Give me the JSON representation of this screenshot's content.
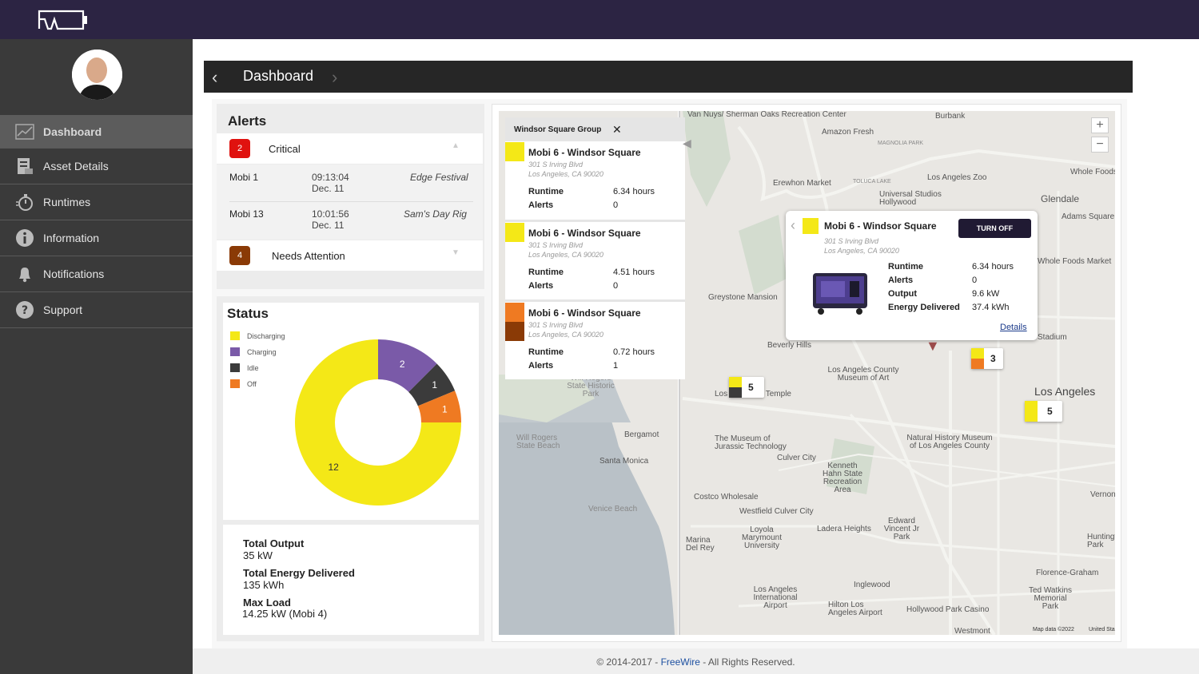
{
  "app": {
    "logo_icon": "freewire-logo-icon",
    "brand_color": "#2c2443"
  },
  "sidebar": {
    "items": [
      {
        "label": "Dashboard",
        "icon": "chart-icon",
        "active": true
      },
      {
        "label": "Asset Details",
        "icon": "asset-icon"
      },
      {
        "label": "Runtimes",
        "icon": "stopwatch-icon"
      },
      {
        "label": "Information",
        "icon": "info-icon"
      },
      {
        "label": "Notifications",
        "icon": "bell-icon"
      },
      {
        "label": "Support",
        "icon": "question-icon"
      }
    ]
  },
  "header": {
    "title": "Dashboard"
  },
  "alerts": {
    "title": "Alerts",
    "critical": {
      "count": "2",
      "label": "Critical",
      "color": "#e0120f"
    },
    "rows": [
      {
        "asset": "Mobi 1",
        "time": "09:13:04",
        "date": "Dec. 11",
        "event": "Edge Festival"
      },
      {
        "asset": "Mobi 13",
        "time": "10:01:56",
        "date": "Dec. 11",
        "event": "Sam's Day Rig"
      }
    ],
    "attention": {
      "count": "4",
      "label": "Needs Attention",
      "color": "#8a3a06"
    }
  },
  "status": {
    "title": "Status",
    "legend": [
      {
        "label": "Discharging",
        "color": "#f4e817"
      },
      {
        "label": "Charging",
        "color": "#7a5aa8"
      },
      {
        "label": "Idle",
        "color": "#3b3b3b"
      },
      {
        "label": "Off",
        "color": "#ef7a22"
      }
    ],
    "chart_data": {
      "type": "pie",
      "categories": [
        "Discharging",
        "Charging",
        "Idle",
        "Off"
      ],
      "values": [
        12,
        2,
        1,
        1
      ],
      "colors": [
        "#f4e817",
        "#7a5aa8",
        "#3b3b3b",
        "#ef7a22"
      ]
    },
    "totals": [
      {
        "label": "Total Output",
        "value": "35 kW"
      },
      {
        "label": "Total Energy Delivered",
        "value": "135 kWh"
      },
      {
        "label": "Max Load",
        "value": "14.25 kW (Mobi 4)"
      }
    ]
  },
  "map": {
    "group": "Windsor Square Group",
    "list": [
      {
        "name": "Mobi 6 - Windsor Square",
        "address1": "301 S Irving Blvd",
        "address2": "Los Angeles, CA 90020",
        "runtime_label": "Runtime",
        "runtime": "6.34 hours",
        "alerts_label": "Alerts",
        "alerts": "0",
        "colors": [
          "#f4e817"
        ]
      },
      {
        "name": "Mobi 6 - Windsor Square",
        "address1": "301 S Irving Blvd",
        "address2": "Los Angeles, CA 90020",
        "runtime_label": "Runtime",
        "runtime": "4.51 hours",
        "alerts_label": "Alerts",
        "alerts": "0",
        "colors": [
          "#f4e817"
        ]
      },
      {
        "name": "Mobi 6 - Windsor Square",
        "address1": "301 S Irving Blvd",
        "address2": "Los Angeles, CA 90020",
        "runtime_label": "Runtime",
        "runtime": "0.72 hours",
        "alerts_label": "Alerts",
        "alerts": "1",
        "colors": [
          "#ef7a22",
          "#8a3a06"
        ]
      }
    ],
    "popup": {
      "name": "Mobi 6 - Windsor Square",
      "address1": "301 S Irving Blvd",
      "address2": "Los Angeles, CA 90020",
      "button": "TURN OFF",
      "fields": [
        {
          "k": "Runtime",
          "v": "6.34 hours"
        },
        {
          "k": "Alerts",
          "v": "0"
        },
        {
          "k": "Output",
          "v": "9.6 kW"
        },
        {
          "k": "Energy Delivered",
          "v": "37.4 kWh"
        }
      ],
      "details": "Details"
    },
    "clusters": [
      "3",
      "5",
      "5"
    ],
    "labels": [
      "Van Nuys/ Sherman Oaks Recreation Center",
      "Burbank",
      "Amazon Fresh",
      "MAGNOLIA PARK",
      "Whole Foods",
      "Los Angeles Zoo",
      "Glendale",
      "Erewhon Market",
      "TOLUCA LAKE",
      "Universal Studios Hollywood",
      "Adams Square",
      "Greystone Mansion",
      "Beverly Hills",
      "Los Angeles County Museum of Art",
      "Los Angeles",
      "Santa Monica",
      "Bergamot",
      "Will Rogers State Historic Park",
      "Will Rogers State Beach",
      "Venice Beach",
      "The Museum of Jurassic Technology",
      "Culver City",
      "Kenneth Hahn State Recreation Area",
      "Natural History Museum of Los Angeles County",
      "Costco Wholesale",
      "Westfield Culver City",
      "Ladera Heights",
      "Loyola Marymount University",
      "Marina Del Rey",
      "Edward Vincent Jr Park",
      "Inglewood",
      "Los Angeles International Airport",
      "Hilton Los Angeles Airport",
      "Hollywood Park Casino",
      "Ted Watkins Memorial Park",
      "Florence-Graham",
      "Vernon",
      "Huntington Park",
      "Westmont",
      "Whole Foods Market",
      "Stadium",
      "Los California Temple",
      "Map data ©2022",
      "United Sta"
    ],
    "zoom_in": "+",
    "zoom_out": "−"
  },
  "footer": {
    "prefix": "© 2014-2017 - ",
    "link": "FreeWire",
    "suffix": " - All Rights Reserved."
  }
}
